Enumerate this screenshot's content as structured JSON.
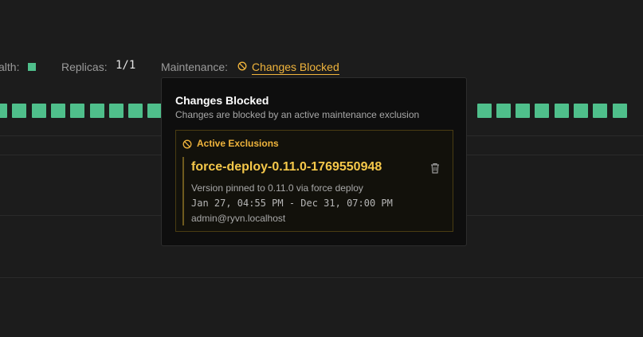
{
  "status": {
    "health_label": "alth:",
    "replicas_label": "Replicas:",
    "replicas_value": "1/1",
    "maintenance_label": "Maintenance:",
    "maintenance_status": "Changes Blocked"
  },
  "colors": {
    "health_ok": "#4fbf8b",
    "warning": "#f0b43c",
    "background": "#1c1c1c",
    "popover_bg": "#0e0e0e"
  },
  "popover": {
    "title": "Changes Blocked",
    "subtitle": "Changes are blocked by an active maintenance exclusion",
    "exclusions_heading": "Active Exclusions",
    "exclusions": [
      {
        "name": "force-deploy-0.11.0-1769550948",
        "reason": "Version pinned to 0.11.0 via force deploy",
        "time_range": "Jan 27, 04:55 PM - Dec 31, 07:00 PM",
        "created_by": "admin@ryvn.localhost",
        "delete_icon": "trash-icon"
      }
    ]
  },
  "icons": {
    "maintenance": "blocked-icon",
    "exclusions": "blocked-icon",
    "delete": "trash-icon"
  }
}
